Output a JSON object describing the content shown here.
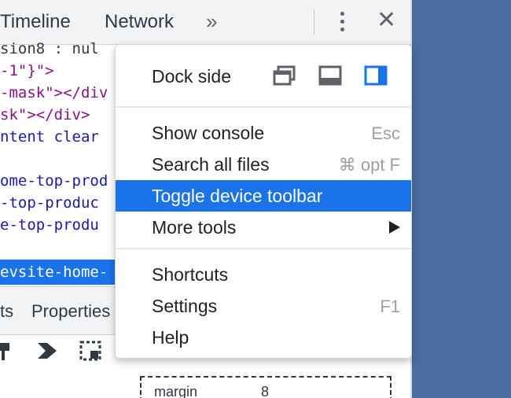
{
  "toolbar": {
    "tabs": [
      "Timeline",
      "Network"
    ],
    "more_tabs": "»",
    "menu_icon": "kebab-menu-icon",
    "close_icon": "close-icon"
  },
  "elements_code": [
    {
      "text": "sion8 : nul",
      "kind": "cut"
    },
    {
      "text": "-1\"}\">",
      "kind": "tag"
    },
    {
      "text": "-mask\"></div",
      "kind": "tag"
    },
    {
      "text": "sk\"></div>",
      "kind": "tag"
    },
    {
      "text": "ntent clear",
      "kind": "str"
    },
    {
      "text": "",
      "kind": "tag"
    },
    {
      "text": "ome-top-prod",
      "kind": "str"
    },
    {
      "text": "-top-produc",
      "kind": "str"
    },
    {
      "text": "e-top-produ",
      "kind": "str"
    },
    {
      "text": "",
      "kind": "tag"
    },
    {
      "text": "",
      "kind": "tag"
    }
  ],
  "selected_node": "evsite-home-",
  "lower_tabs": [
    "ts",
    "Properties"
  ],
  "style_tools": [
    "pin-icon",
    "diamond-icon",
    "element-select-icon"
  ],
  "box_model": {
    "margin_label": "margin",
    "margin_value": "8"
  },
  "menu": {
    "dock_side_label": "Dock side",
    "dock_options": [
      "undock-icon",
      "dock-bottom-icon",
      "dock-right-icon"
    ],
    "dock_selected": "dock-right-icon",
    "items": [
      {
        "label": "Show console",
        "shortcut": "Esc"
      },
      {
        "label": "Search all files",
        "shortcut": "⌘ opt F"
      },
      {
        "label": "Toggle device toolbar",
        "shortcut": "",
        "highlighted": true
      },
      {
        "label": "More tools",
        "shortcut": "",
        "submenu": true
      },
      {
        "label": "Shortcuts",
        "shortcut": ""
      },
      {
        "label": "Settings",
        "shortcut": "F1"
      },
      {
        "label": "Help",
        "shortcut": ""
      }
    ]
  },
  "colors": {
    "highlight": "#1a73e8",
    "desktop": "#4a6d9f"
  }
}
